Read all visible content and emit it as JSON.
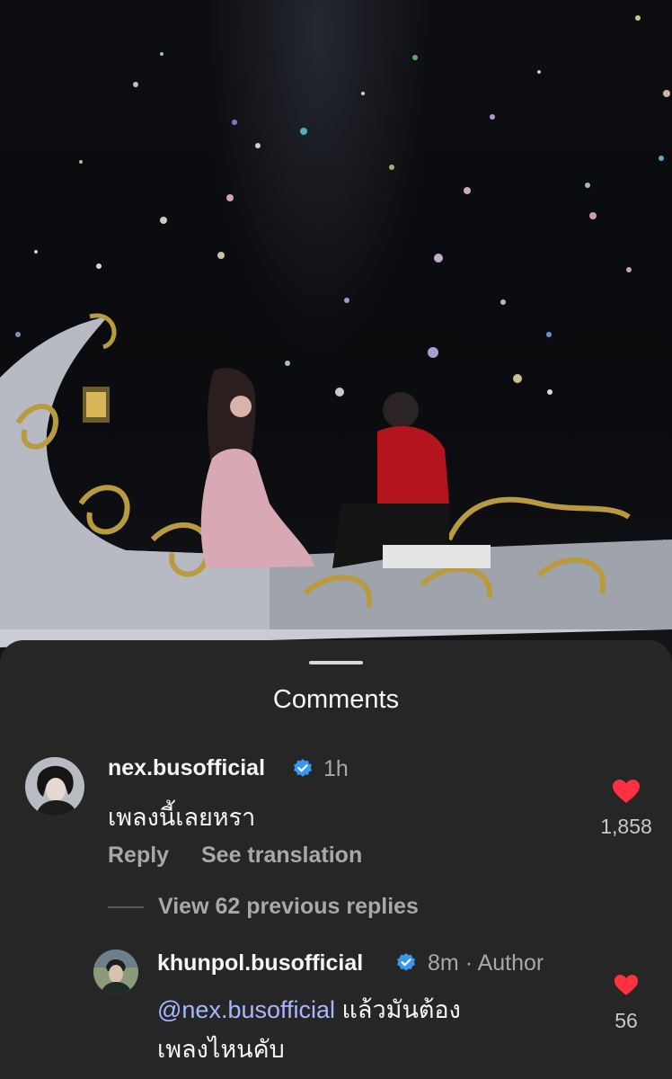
{
  "sheet": {
    "title": "Comments"
  },
  "comments": [
    {
      "username": "nex.busofficial",
      "verified": true,
      "time": "1h",
      "text": "เพลงนี้เลยหรา",
      "reply_label": "Reply",
      "translate_label": "See translation",
      "likes": "1,858",
      "liked": true
    }
  ],
  "view_replies_label": "View 62 previous replies",
  "reply": {
    "username": "khunpol.busofficial",
    "verified": true,
    "time": "8m",
    "separator": "·",
    "author_label": "Author",
    "mention": "@nex.busofficial",
    "text_line1": " แล้วมันต้อง",
    "text_line2": "เพลงไหนคับ",
    "likes": "56",
    "liked": true
  },
  "colors": {
    "sheet_bg": "#262626",
    "heart": "#ff3040",
    "verified": "#3897f0",
    "mention": "#a9b7ff",
    "muted_text": "#a8a8a8"
  },
  "icons": [
    "heart-icon",
    "verified-badge-icon"
  ]
}
